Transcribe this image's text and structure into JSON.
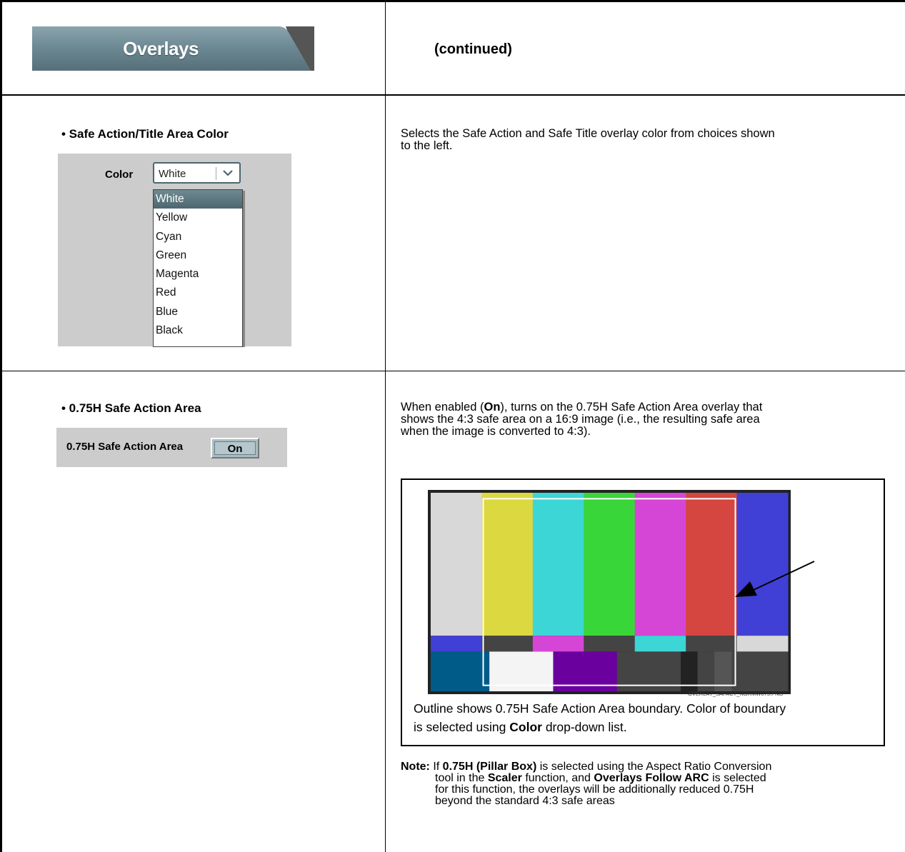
{
  "header": {
    "tab_title": "Overlays",
    "continued": "(continued)"
  },
  "safe_color": {
    "title": "• Safe Action/Title Area Color",
    "description_lines": [
      "Selects the Safe Action and Safe Title overlay color from choices shown",
      "to the left."
    ],
    "control_label": "Color",
    "selected_value": "White",
    "options": [
      "White",
      "Yellow",
      "Cyan",
      "Green",
      "Magenta",
      "Red",
      "Blue",
      "Black"
    ]
  },
  "safe_action": {
    "title": "• 0.75H Safe Action Area",
    "control_label": "0.75H Safe Action Area",
    "button_label": "On",
    "description": {
      "pre": "When enabled (",
      "bold": "On",
      "post_line1": "), turns on the 0.75H Safe Action Area overlay that",
      "line2": "shows the 4:3 safe area on a 16:9 image (i.e., the resulting safe area",
      "line3": "when the image is converted to 4:3)."
    },
    "figure": {
      "filename": "OVERLAY_SAFACT_NORMW075.PNG",
      "bar_colors": [
        "#d8d8d8",
        "#dcd840",
        "#3dd6d6",
        "#38d638",
        "#d646d6",
        "#d64640",
        "#4040d6"
      ],
      "caption_line1": "Outline shows 0.75H Safe Action Area boundary. Color of boundary",
      "caption_pre": "is selected using ",
      "caption_bold": "Color",
      "caption_post": " drop-down list."
    },
    "note": {
      "label": "Note:",
      "p1": " If ",
      "b1": "0.75H (Pillar Box)",
      "p2": " is selected using the Aspect Ratio Conversion",
      "p3": "tool in the ",
      "b2": "Scaler",
      "p4": " function, and ",
      "b3": "Overlays Follow ARC",
      "p5": " is selected",
      "line3": "for this function, the overlays will be additionally reduced 0.75H",
      "line4": "beyond the standard 4:3 safe areas"
    }
  }
}
